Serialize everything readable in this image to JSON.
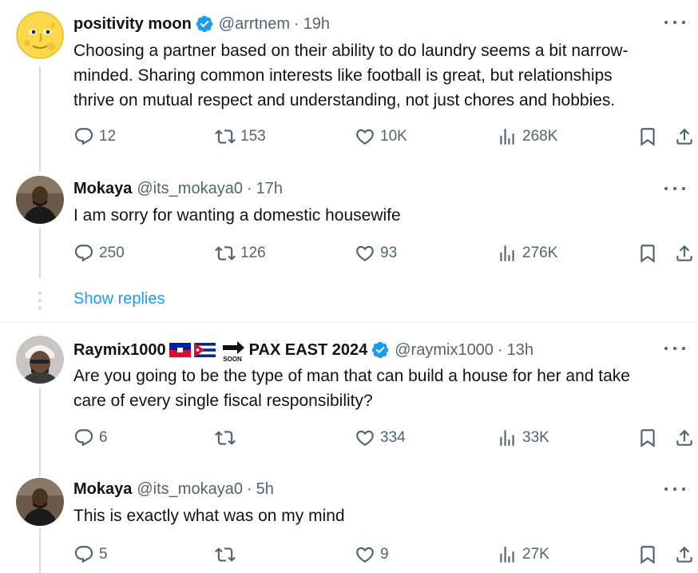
{
  "tweets": [
    {
      "display_name": "positivity moon",
      "handle": "@arrtnem",
      "separator": "·",
      "time": "19h",
      "verified": true,
      "avatar": "moon-face-emoji",
      "text": "Choosing a partner based on their ability to do laundry seems a bit narrow-\nminded. Sharing common interests like football is great, but relationships\nthrive on mutual respect and understanding, not just chores and hobbies.",
      "replies": "12",
      "reposts": "153",
      "likes": "10K",
      "views": "268K"
    },
    {
      "display_name": "Mokaya",
      "handle": "@its_mokaya0",
      "separator": "·",
      "time": "17h",
      "verified": false,
      "avatar": "user-photo",
      "text": "I am sorry for wanting a domestic housewife",
      "replies": "250",
      "reposts": "126",
      "likes": "93",
      "views": "276K"
    },
    {
      "display_name": "Raymix1000",
      "display_name_suffix": "PAX EAST 2024",
      "handle": "@raymix1000",
      "separator": "·",
      "time": "13h",
      "verified": true,
      "avatar": "user-photo",
      "text": "Are you going to be the type of man that can build a house for her and take\ncare of every single fiscal responsibility?",
      "replies": "6",
      "reposts": "",
      "likes": "334",
      "views": "33K"
    },
    {
      "display_name": "Mokaya",
      "handle": "@its_mokaya0",
      "separator": "·",
      "time": "5h",
      "verified": false,
      "avatar": "user-photo",
      "text": "This is exactly what was on my mind",
      "replies": "5",
      "reposts": "",
      "likes": "9",
      "views": "27K"
    }
  ],
  "show_replies_label": "Show replies",
  "soon_label": "SOON",
  "colors": {
    "accent": "#1d9bf0",
    "secondary_text": "#536471",
    "primary_text": "#0f1419",
    "thread_line": "#cfd9de"
  },
  "icons": [
    "reply-icon",
    "repost-icon",
    "like-icon",
    "views-icon",
    "bookmark-icon",
    "share-icon",
    "more-icon",
    "verified-badge-icon"
  ]
}
